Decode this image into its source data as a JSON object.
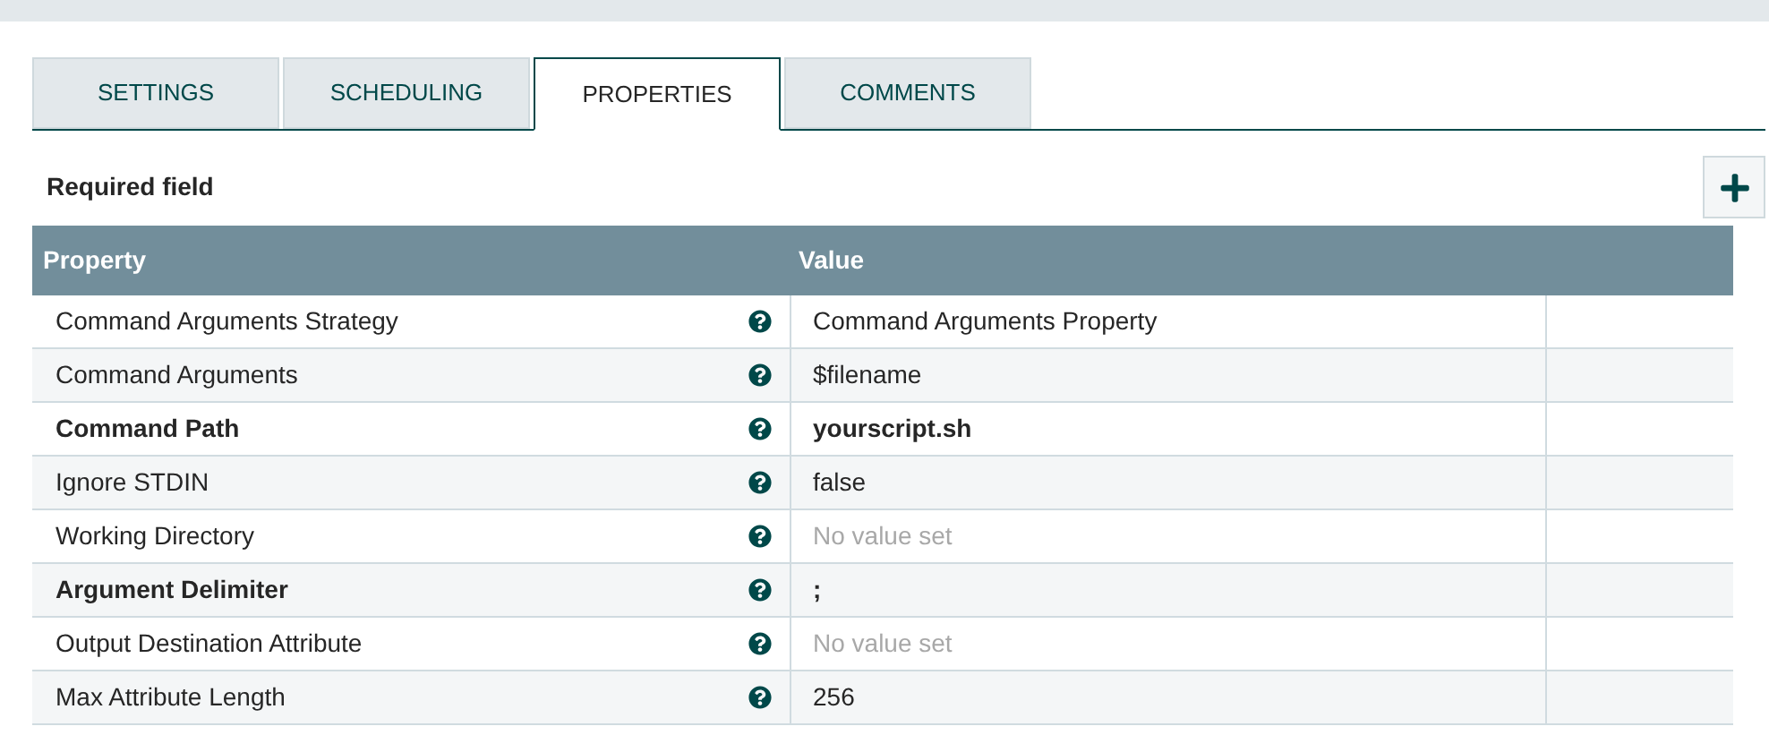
{
  "tabs": [
    {
      "label": "SETTINGS",
      "selected": false
    },
    {
      "label": "SCHEDULING",
      "selected": false
    },
    {
      "label": "PROPERTIES",
      "selected": true
    },
    {
      "label": "COMMENTS",
      "selected": false
    }
  ],
  "required_label": "Required field",
  "table": {
    "columns": [
      "Property",
      "Value"
    ],
    "rows": [
      {
        "property": "Command Arguments Strategy",
        "value": "Command Arguments Property",
        "required": false,
        "value_set": true
      },
      {
        "property": "Command Arguments",
        "value": "$filename",
        "required": false,
        "value_set": true
      },
      {
        "property": "Command Path",
        "value": "yourscript.sh",
        "required": true,
        "value_set": true
      },
      {
        "property": "Ignore STDIN",
        "value": "false",
        "required": false,
        "value_set": true
      },
      {
        "property": "Working Directory",
        "value": "No value set",
        "required": false,
        "value_set": false
      },
      {
        "property": "Argument Delimiter",
        "value": ";",
        "required": true,
        "value_set": true
      },
      {
        "property": "Output Destination Attribute",
        "value": "No value set",
        "required": false,
        "value_set": false
      },
      {
        "property": "Max Attribute Length",
        "value": "256",
        "required": false,
        "value_set": true
      }
    ]
  }
}
